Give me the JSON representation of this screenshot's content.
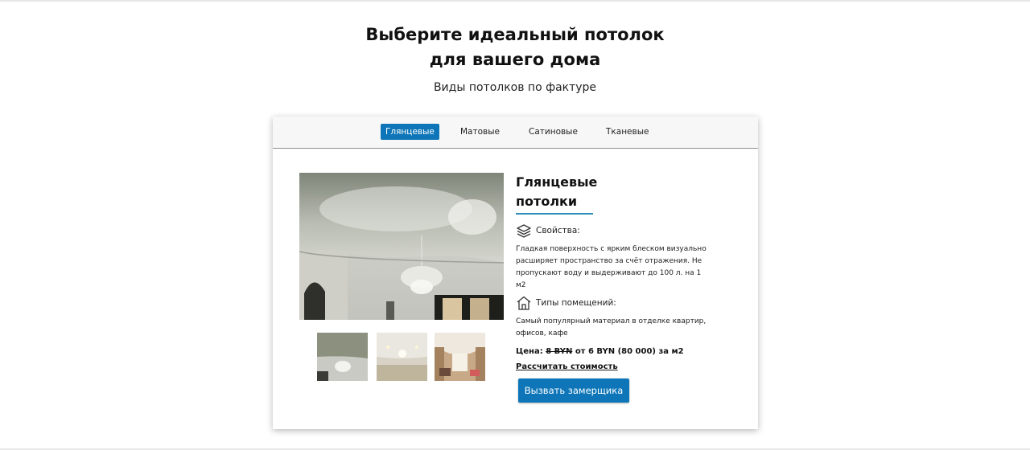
{
  "heading": {
    "line1": "Выберите идеальный потолок",
    "line2": "для вашего дома"
  },
  "subheading": "Виды потолков по фактуре",
  "tabs": [
    {
      "label": "Глянцевые",
      "active": true
    },
    {
      "label": "Матовые",
      "active": false
    },
    {
      "label": "Сатиновые",
      "active": false
    },
    {
      "label": "Тканевые",
      "active": false
    }
  ],
  "product": {
    "title_line1": "Глянцевые",
    "title_line2": "потолки",
    "properties_label": "Свойства:",
    "properties_lines": [
      "Гладкая поверхность с ярким блеском визуально",
      "расширяет пространство за счёт отражения. Не",
      "пропускают воду и выдерживают до 100 л. на 1 м2"
    ],
    "rooms_label": "Типы помещений:",
    "rooms_lines": [
      "Самый популярный материал в отделке квартир,",
      "офисов, кафе"
    ],
    "price_label": "Цена:",
    "price_old": "8 BYN",
    "price_new": "от 6 BYN (80 000) за м2",
    "calc_link": "Рассчитать стоимость",
    "cta_button": "Вызвать замерщика"
  },
  "icons": {
    "properties": "layers-icon",
    "rooms": "house-icon"
  },
  "colors": {
    "accent": "#0e76b8",
    "title_underline": "#2d8fb8"
  }
}
